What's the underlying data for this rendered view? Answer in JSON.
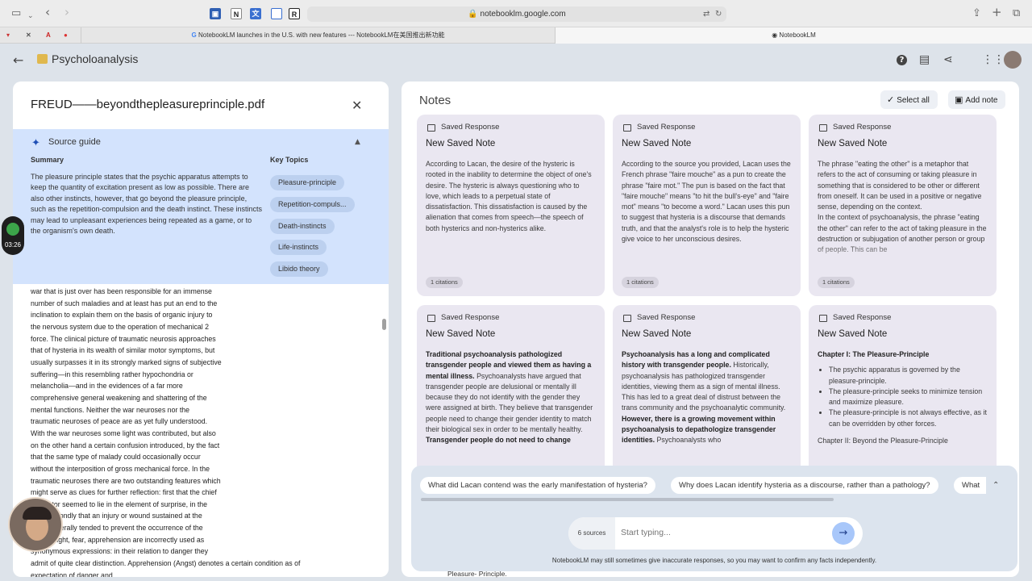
{
  "browser": {
    "url": "notebooklm.google.com",
    "tabs": [
      "NotebookLM launches in the U.S. with new features --- NotebookLM在美国推出新功能",
      "NotebookLM"
    ],
    "extension_icons": [
      "notion-icon",
      "r-icon"
    ]
  },
  "app": {
    "notebook_title": "Psycholoanalysis"
  },
  "source": {
    "file_name": "FREUD——beyondthepleasureprinciple.pdf",
    "guide_title": "Source guide",
    "summary_heading": "Summary",
    "summary_text": "The pleasure principle states that the psychic apparatus attempts to keep the quantity of excitation present as low as possible. There are also other instincts, however, that go beyond the pleasure principle, such as the repetition-compulsion and the death instinct. These instincts may lead to unpleasant experiences being repeated as a game, or to the organism's own death.",
    "topics_heading": "Key Topics",
    "topics": [
      "Pleasure-principle",
      "Repetition-compuls...",
      "Death-instincts",
      "Life-instincts",
      "Libido theory"
    ],
    "body_text": "war that is just over has been responsible for an immense\nnumber of such maladies and at least has put an end to the\ninclination to explain them on the basis of organic injury to\nthe nervous system due to the operation of mechanical 2\nforce. The clinical picture of traumatic neurosis approaches\nthat of hysteria in its wealth of similar motor symptoms, but\nusually surpasses it in its strongly marked signs of subjective\nsuffering—in this resembling rather hypochondria or\nmelancholia—and in the evidences of a far more\ncomprehensive general weakening and shattering of the\nmental functions. Neither the war neuroses nor the\ntraumatic neuroses of peace are as yet fully understood.\nWith the war neuroses some light was contributed, but also\non the other hand a certain confusion introduced, by the fact\nthat the same type of malady could occasionally occur\nwithout the interposition of gross mechanical force. In the\ntraumatic neuroses there are two outstanding features which\nmight serve as clues for further reflection: first that the chief\n      factor seemed to lie in the element of surprise, in the\n      d secondly that an injury or wound sustained at the\n      e generally tended to prevent the occurrence of the\n      s. Fright, fear, apprehension are incorrectly used as\nsynonymous expressions: in their relation to danger they\nadmit of quite clear distinction. Apprehension (Angst) denotes a certain condition as of\nexpectation of danger and"
  },
  "timer": {
    "time": "03:26"
  },
  "notes": {
    "heading": "Notes",
    "select_all": "Select all",
    "add_note": "Add note",
    "cards": [
      {
        "type": "Saved Response",
        "title": "New Saved Note",
        "body": "According to Lacan, the desire of the hysteric is rooted in the inability to determine the object of one's desire. The hysteric is always questioning who to love, which leads to a perpetual state of dissatisfaction. This dissatisfaction is caused by the alienation that comes from speech—the speech of both hysterics and non-hysterics alike.",
        "citations": "1 citations"
      },
      {
        "type": "Saved Response",
        "title": "New Saved Note",
        "body": "According to the source you provided, Lacan uses the French phrase \"faire mouche\" as a pun to create the phrase \"faire mot.\" The pun is based on the fact that \"faire mouche\" means \"to hit the bull's-eye\" and \"faire mot\" means \"to become a word.\" Lacan uses this pun to suggest that hysteria is a discourse that demands truth, and that the analyst's role is to help the hysteric give voice to her unconscious desires.",
        "citations": "1 citations"
      },
      {
        "type": "Saved Response",
        "title": "New Saved Note",
        "body": "The phrase \"eating the other\" is a metaphor that refers to the act of consuming or taking pleasure in something that is considered to be other or different from oneself. It can be used in a positive or negative sense, depending on the context.",
        "body2": "In the context of psychoanalysis, the phrase \"eating the other\" can refer to the act of taking pleasure in the destruction or subjugation of another person or group of people. This can be",
        "citations": "1 citations"
      },
      {
        "type": "Saved Response",
        "title": "New Saved Note",
        "bold": "Traditional psychoanalysis pathologized transgender people and viewed them as having a mental illness.",
        "body": " Psychoanalysts have argued that transgender people are delusional or mentally ill because they do not identify with the gender they were assigned at birth. They believe that transgender people need to change their gender identity to match their biological sex in order to be mentally healthy.",
        "bold2": "Transgender people do not need to change"
      },
      {
        "type": "Saved Response",
        "title": "New Saved Note",
        "bold": "Psychoanalysis has a long and complicated history with transgender people.",
        "body": " Historically, psychoanalysis has pathologized transgender identities, viewing them as a sign of mental illness. This has led to a great deal of distrust between the trans community and the psychoanalytic community.",
        "bold2": "However, there is a growing movement within psychoanalysis to depathologize transgender identities.",
        "body2": " Psychoanalysts who"
      },
      {
        "type": "Saved Response",
        "title": "New Saved Note",
        "bold": "Chapter I: The Pleasure-Principle",
        "bullets": [
          "The psychic apparatus is governed by the pleasure-principle.",
          "The pleasure-principle seeks to minimize tension and maximize pleasure.",
          "The pleasure-principle is not always effective, as it can be overridden by other forces."
        ],
        "body2": "Chapter II: Beyond the Pleasure-Principle"
      }
    ]
  },
  "chat": {
    "suggestions": [
      "What did Lacan contend was the early manifestation of hysteria?",
      "Why does Lacan identify hysteria as a discourse, rather than a pathology?",
      "What"
    ],
    "sources_count": "6 sources",
    "placeholder": "Start typing...",
    "disclaimer": "NotebookLM may still sometimes give inaccurate responses, so you may want to confirm any facts independently.",
    "behind_text": "Pleasure- Principle."
  }
}
